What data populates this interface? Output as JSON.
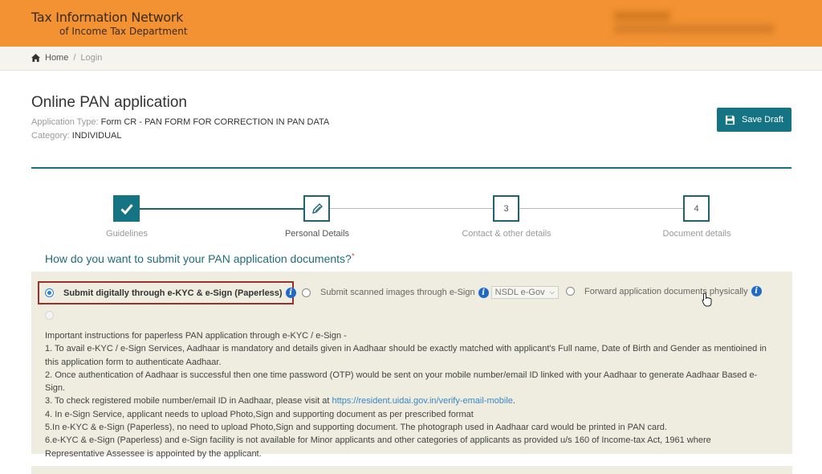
{
  "header": {
    "brand_line1": "Tax Information Network",
    "brand_line2": "of Income Tax Department",
    "user_info": "[blurred]"
  },
  "breadcrumb": {
    "home_icon": "home-icon",
    "items": [
      "Home",
      "Login"
    ],
    "separator": "/"
  },
  "page": {
    "title": "Online PAN application",
    "application_type_label": "Application Type:",
    "application_type_value": "Form CR - PAN FORM FOR CORRECTION IN PAN DATA",
    "category_label": "Category:",
    "category_value": "INDIVIDUAL",
    "save_draft_label": "Save Draft",
    "save_icon": "floppy-disk-icon"
  },
  "stepper": {
    "steps": [
      {
        "marker": "check-icon",
        "label": "Guidelines",
        "state": "completed"
      },
      {
        "marker": "pencil-icon",
        "label": "Personal Details",
        "state": "active"
      },
      {
        "marker": "3",
        "label": "Contact & other details",
        "state": "pending"
      },
      {
        "marker": "4",
        "label": "Document details",
        "state": "pending"
      }
    ]
  },
  "submission": {
    "question": "How do you want to submit your PAN application documents?",
    "required_mark": "*",
    "options": [
      {
        "label": "Submit digitally through e-KYC & e-Sign (Paperless)",
        "selected": true,
        "info_icon": "info-icon"
      },
      {
        "label": "Submit scanned images through e-Sign",
        "selected": false,
        "info_icon": "info-icon",
        "provider_select": "NSDL e-Gov"
      },
      {
        "label": "Forward application documents physically",
        "selected": false,
        "info_icon": "info-icon"
      }
    ]
  },
  "instructions": {
    "heading": "Important instructions for paperless PAN application through e-KYC / e-Sign -",
    "item1": "1. To avail e-KYC / e-Sign Services, Aadhaar is mandatory and details given in Aadhaar should be exactly matched with applicant's Full name, Date of Birth and Gender as mentioined in this application form to authenticate Aadhaar.",
    "item2": "2. Once authentication of Aadhaar is successful then one time password (OTP) would be sent on your mobile number/email ID linked with your Aadhaar to generate Aadhaar Based e-Sign.",
    "item3_prefix": "3. To check registered mobile number/email ID in Aadhaar, please visit at ",
    "item3_link": "https://resident.uidai.gov.in/verify-email-mobile",
    "item3_suffix": ".",
    "item4": "4. In e-Sign Service, applicant needs to upload Photo,Sign and supporting document as per prescribed format",
    "item5": "5.In e-KYC & e-Sign (Paperless), no need to upload Photo,Sign and supporting document. The photograph used in Aadhaar card would be printed in PAN card.",
    "item6": "6.e-KYC & e-Sign (Paperless) and e-Sign facility is not available for Minor applicants and other categories of applicants as provided u/s 160 of Income-tax Act, 1961 where Representative Assessee is appointed by the applicant."
  },
  "colors": {
    "header_orange": "#f39232",
    "accent_teal": "#147484",
    "panel_beige": "#eeede0",
    "highlight_red": "#9b2f2b",
    "info_blue": "#1f6ac9"
  }
}
